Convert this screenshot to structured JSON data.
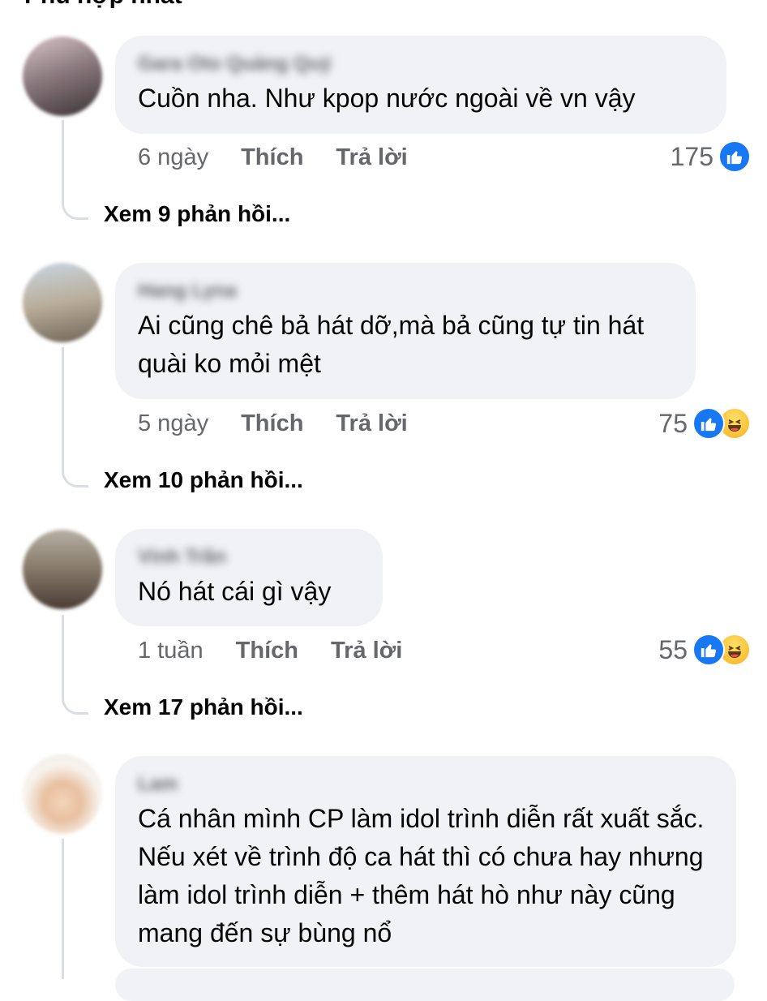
{
  "header": {
    "title": "Phù hợp nhất"
  },
  "comments": [
    {
      "author": "Gara Oto Quảng Quý",
      "text": "Cuồn nha. Như kpop nước ngoài về vn vậy",
      "time": "6 ngày",
      "like_label": "Thích",
      "reply_label": "Trả lời",
      "reaction_count": "175",
      "reactions": [
        "like"
      ],
      "view_replies": "Xem 9 phản hồi..."
    },
    {
      "author": "Hang Lyna",
      "text": "Ai cũng chê bả hát dỡ,mà bả cũng tự tin hát quài ko mỏi mệt",
      "time": "5 ngày",
      "like_label": "Thích",
      "reply_label": "Trả lời",
      "reaction_count": "75",
      "reactions": [
        "like",
        "haha"
      ],
      "view_replies": "Xem 10 phản hồi..."
    },
    {
      "author": "Vinh Trần",
      "text": "Nó hát cái gì vậy",
      "time": "1 tuần",
      "like_label": "Thích",
      "reply_label": "Trả lời",
      "reaction_count": "55",
      "reactions": [
        "like",
        "haha"
      ],
      "view_replies": "Xem 17 phản hồi..."
    },
    {
      "author": "Lam",
      "text": "Cá nhân mình CP làm idol trình diễn rất xuất sắc. Nếu xét về trình độ ca hát thì có chưa hay nhưng làm idol trình diễn + thêm hát hò như này cũng mang đến sự bùng nổ"
    }
  ],
  "colors": {
    "bubble": "#f0f2f5",
    "secondary_text": "#65676b",
    "like_blue": "#1877f2",
    "haha_yellow": "#f7b125"
  }
}
